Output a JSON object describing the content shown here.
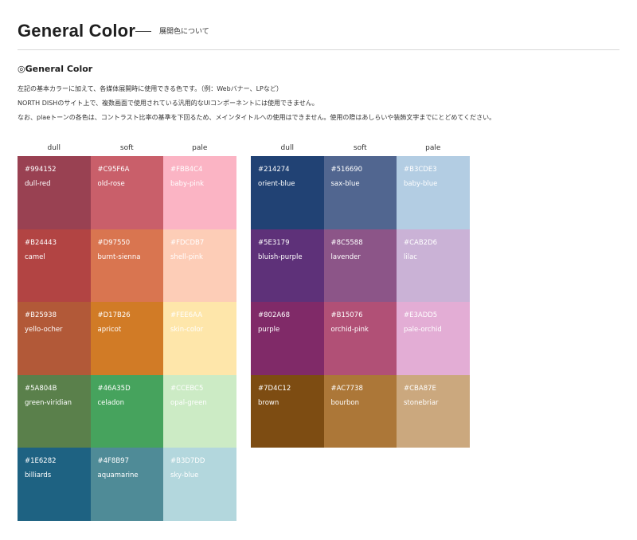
{
  "header": {
    "title": "General Color",
    "subtitle": "展開色について"
  },
  "section": {
    "heading": "◎General Color",
    "description": [
      "左記の基本カラーに加えて、各媒体展開時に使用できる色です。（例：Webバナー、LPなど）",
      "NORTH DISHのサイト上で、複数画面で使用されている汎用的なUIコンポーネントには使用できません。",
      "なお、plaeトーンの各色は、コントラスト比率の基準を下回るため、メインタイトルへの使用はできません。使用の際はあしらいや装飾文字までにとどめてください。"
    ]
  },
  "palettes": [
    {
      "headers": [
        "dull",
        "soft",
        "pale"
      ],
      "rows": [
        [
          {
            "code": "#994152",
            "name": "dull-red",
            "color": "#994152",
            "text": "#ffffff"
          },
          {
            "code": "#C95F6A",
            "name": "old-rose",
            "color": "#C95F6A",
            "text": "#ffffff"
          },
          {
            "code": "#FBB4C4",
            "name": "baby-pink",
            "color": "#FBB4C4",
            "text": "#ffffff"
          }
        ],
        [
          {
            "code": "#B24443",
            "name": "camel",
            "color": "#B24443",
            "text": "#ffffff"
          },
          {
            "code": "#D97550",
            "name": "burnt-sienna",
            "color": "#D97550",
            "text": "#ffffff"
          },
          {
            "code": "#FDCDB7",
            "name": "shell-pink",
            "color": "#FDCDB7",
            "text": "#ffffff"
          }
        ],
        [
          {
            "code": "#B25938",
            "name": "yello-ocher",
            "color": "#B25938",
            "text": "#ffffff"
          },
          {
            "code": "#D17B26",
            "name": "apricot",
            "color": "#D17B26",
            "text": "#ffffff"
          },
          {
            "code": "#FEE6AA",
            "name": "skin-color",
            "color": "#FEE6AA",
            "text": "#ffffff"
          }
        ],
        [
          {
            "code": "#5A804B",
            "name": "green-viridian",
            "color": "#5A804B",
            "text": "#ffffff"
          },
          {
            "code": "#46A35D",
            "name": "celadon",
            "color": "#46A35D",
            "text": "#ffffff"
          },
          {
            "code": "#CCEBC5",
            "name": "opal-green",
            "color": "#CCEBC5",
            "text": "#ffffff"
          }
        ],
        [
          {
            "code": "#1E6282",
            "name": "billiards",
            "color": "#1E6282",
            "text": "#ffffff"
          },
          {
            "code": "#4F8B97",
            "name": "aquamarine",
            "color": "#4F8B97",
            "text": "#ffffff"
          },
          {
            "code": "#B3D7DD",
            "name": "sky-blue",
            "color": "#B3D7DD",
            "text": "#ffffff"
          }
        ]
      ]
    },
    {
      "headers": [
        "dull",
        "soft",
        "pale"
      ],
      "rows": [
        [
          {
            "code": "#214274",
            "name": "orient-blue",
            "color": "#214274",
            "text": "#ffffff"
          },
          {
            "code": "#516690",
            "name": "sax-blue",
            "color": "#516690",
            "text": "#ffffff"
          },
          {
            "code": "#B3CDE3",
            "name": "baby-blue",
            "color": "#B3CDE3",
            "text": "#ffffff"
          }
        ],
        [
          {
            "code": "#5E3179",
            "name": "bluish-purple",
            "color": "#5E3179",
            "text": "#ffffff"
          },
          {
            "code": "#8C5588",
            "name": "lavender",
            "color": "#8C5588",
            "text": "#ffffff"
          },
          {
            "code": "#CAB2D6",
            "name": "lilac",
            "color": "#CAB2D6",
            "text": "#ffffff"
          }
        ],
        [
          {
            "code": "#802A68",
            "name": "purple",
            "color": "#802A68",
            "text": "#ffffff"
          },
          {
            "code": "#B15076",
            "name": "orchid-pink",
            "color": "#B15076",
            "text": "#ffffff"
          },
          {
            "code": "#E3ADD5",
            "name": "pale-orchid",
            "color": "#E3ADD5",
            "text": "#ffffff"
          }
        ],
        [
          {
            "code": "#7D4C12",
            "name": "brown",
            "color": "#7D4C12",
            "text": "#ffffff"
          },
          {
            "code": "#AC7738",
            "name": "bourbon",
            "color": "#AC7738",
            "text": "#ffffff"
          },
          {
            "code": "#CBA87E",
            "name": "stonebriar",
            "color": "#CBA87E",
            "text": "#ffffff"
          }
        ]
      ]
    }
  ]
}
